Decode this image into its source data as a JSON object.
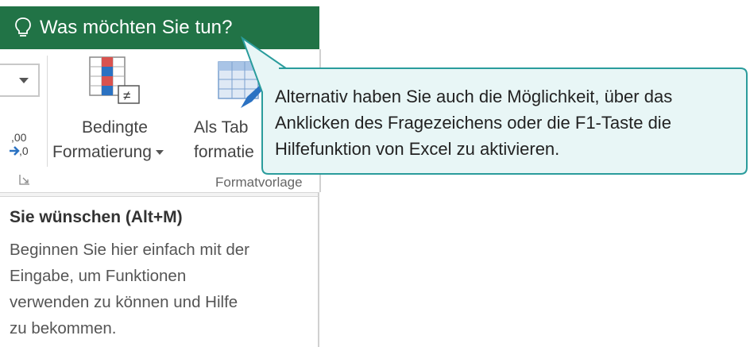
{
  "tellme": {
    "icon": "lightbulb-icon",
    "placeholder": "Was möchten Sie tun?"
  },
  "ribbon": {
    "number_format_dropdown_icon": "chevron-down-icon",
    "decrease_decimal_icon": "decrease-decimal-icon",
    "decrease_decimal_text": ",00 →,0",
    "dialog_launcher_icon": "dialog-launcher-icon",
    "conditional_formatting": {
      "icon": "conditional-formatting-icon",
      "line1": "Bedingte",
      "line2": "Formatierung"
    },
    "format_as_table": {
      "icon": "format-as-table-icon",
      "line1": "Als Tab",
      "line2": "formatie"
    },
    "group_name": "Formatvorlage"
  },
  "tooltip": {
    "title": "Sie wünschen (Alt+M)",
    "lines": [
      "Beginnen Sie hier einfach mit der",
      "Eingabe, um Funktionen",
      "verwenden zu können und Hilfe",
      "zu bekommen."
    ]
  },
  "callout": {
    "lines": [
      "Alternativ haben Sie auch die Möglichkeit, über das",
      "Anklicken des Fragezeichens oder die F1-Taste die",
      "Hilfefunktion von Excel zu aktivieren."
    ]
  },
  "colors": {
    "excel_green": "#217346",
    "callout_fill": "#e8f6f6",
    "callout_border": "#2a9c9c"
  }
}
